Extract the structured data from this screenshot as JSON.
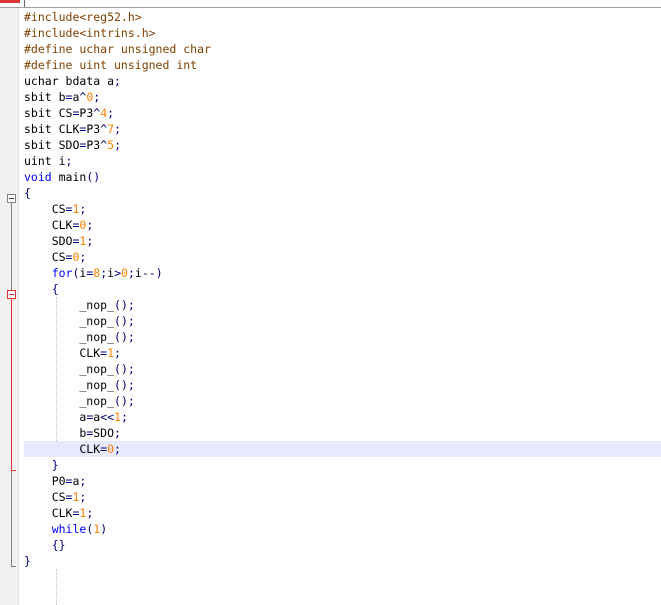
{
  "editor": {
    "lines": [
      [
        {
          "t": "#include<reg52.h>",
          "c": "pp"
        }
      ],
      [
        {
          "t": "#include<intrins.h>",
          "c": "pp"
        }
      ],
      [
        {
          "t": "#define uchar unsigned char",
          "c": "pp"
        }
      ],
      [
        {
          "t": "#define uint unsigned int",
          "c": "pp"
        }
      ],
      [
        {
          "t": "uchar bdata a",
          "c": "id"
        },
        {
          "t": ";",
          "c": "op"
        }
      ],
      [
        {
          "t": "sbit b",
          "c": "id"
        },
        {
          "t": "=",
          "c": "op"
        },
        {
          "t": "a",
          "c": "id"
        },
        {
          "t": "^",
          "c": "op"
        },
        {
          "t": "0",
          "c": "num"
        },
        {
          "t": ";",
          "c": "op"
        }
      ],
      [
        {
          "t": "sbit CS",
          "c": "id"
        },
        {
          "t": "=",
          "c": "op"
        },
        {
          "t": "P3",
          "c": "id"
        },
        {
          "t": "^",
          "c": "op"
        },
        {
          "t": "4",
          "c": "num"
        },
        {
          "t": ";",
          "c": "op"
        }
      ],
      [
        {
          "t": "sbit CLK",
          "c": "id"
        },
        {
          "t": "=",
          "c": "op"
        },
        {
          "t": "P3",
          "c": "id"
        },
        {
          "t": "^",
          "c": "op"
        },
        {
          "t": "7",
          "c": "num"
        },
        {
          "t": ";",
          "c": "op"
        }
      ],
      [
        {
          "t": "sbit SDO",
          "c": "id"
        },
        {
          "t": "=",
          "c": "op"
        },
        {
          "t": "P3",
          "c": "id"
        },
        {
          "t": "^",
          "c": "op"
        },
        {
          "t": "5",
          "c": "num"
        },
        {
          "t": ";",
          "c": "op"
        }
      ],
      [
        {
          "t": "uint i",
          "c": "id"
        },
        {
          "t": ";",
          "c": "op"
        }
      ],
      [
        {
          "t": "void",
          "c": "kw"
        },
        {
          "t": " main",
          "c": "id"
        },
        {
          "t": "()",
          "c": "op"
        }
      ],
      [
        {
          "t": "{",
          "c": "op"
        }
      ],
      [
        {
          "t": "    CS",
          "c": "id"
        },
        {
          "t": "=",
          "c": "op"
        },
        {
          "t": "1",
          "c": "num"
        },
        {
          "t": ";",
          "c": "op"
        }
      ],
      [
        {
          "t": "    CLK",
          "c": "id"
        },
        {
          "t": "=",
          "c": "op"
        },
        {
          "t": "0",
          "c": "num"
        },
        {
          "t": ";",
          "c": "op"
        }
      ],
      [
        {
          "t": "    SDO",
          "c": "id"
        },
        {
          "t": "=",
          "c": "op"
        },
        {
          "t": "1",
          "c": "num"
        },
        {
          "t": ";",
          "c": "op"
        }
      ],
      [
        {
          "t": "    CS",
          "c": "id"
        },
        {
          "t": "=",
          "c": "op"
        },
        {
          "t": "0",
          "c": "num"
        },
        {
          "t": ";",
          "c": "op"
        }
      ],
      [
        {
          "t": "    for",
          "c": "kw"
        },
        {
          "t": "(",
          "c": "op"
        },
        {
          "t": "i",
          "c": "id"
        },
        {
          "t": "=",
          "c": "op"
        },
        {
          "t": "8",
          "c": "num"
        },
        {
          "t": ";",
          "c": "op"
        },
        {
          "t": "i",
          "c": "id"
        },
        {
          "t": ">",
          "c": "op"
        },
        {
          "t": "0",
          "c": "num"
        },
        {
          "t": ";",
          "c": "op"
        },
        {
          "t": "i",
          "c": "id"
        },
        {
          "t": "--)",
          "c": "op"
        }
      ],
      [
        {
          "t": "    {",
          "c": "op"
        }
      ],
      [
        {
          "t": "        _nop_",
          "c": "id"
        },
        {
          "t": "();",
          "c": "op"
        }
      ],
      [
        {
          "t": "        _nop_",
          "c": "id"
        },
        {
          "t": "();",
          "c": "op"
        }
      ],
      [
        {
          "t": "        _nop_",
          "c": "id"
        },
        {
          "t": "();",
          "c": "op"
        }
      ],
      [
        {
          "t": "        CLK",
          "c": "id"
        },
        {
          "t": "=",
          "c": "op"
        },
        {
          "t": "1",
          "c": "num"
        },
        {
          "t": ";",
          "c": "op"
        }
      ],
      [
        {
          "t": "        _nop_",
          "c": "id"
        },
        {
          "t": "();",
          "c": "op"
        }
      ],
      [
        {
          "t": "        _nop_",
          "c": "id"
        },
        {
          "t": "();",
          "c": "op"
        }
      ],
      [
        {
          "t": "        _nop_",
          "c": "id"
        },
        {
          "t": "();",
          "c": "op"
        }
      ],
      [
        {
          "t": "        a",
          "c": "id"
        },
        {
          "t": "=",
          "c": "op"
        },
        {
          "t": "a",
          "c": "id"
        },
        {
          "t": "<<",
          "c": "op"
        },
        {
          "t": "1",
          "c": "num"
        },
        {
          "t": ";",
          "c": "op"
        }
      ],
      [
        {
          "t": "        b",
          "c": "id"
        },
        {
          "t": "=",
          "c": "op"
        },
        {
          "t": "SDO",
          "c": "id"
        },
        {
          "t": ";",
          "c": "op"
        }
      ],
      [
        {
          "t": "        CLK",
          "c": "id"
        },
        {
          "t": "=",
          "c": "op"
        },
        {
          "t": "0",
          "c": "num"
        },
        {
          "t": ";",
          "c": "op"
        }
      ],
      [
        {
          "t": "    }",
          "c": "op"
        }
      ],
      [
        {
          "t": "    P0",
          "c": "id"
        },
        {
          "t": "=",
          "c": "op"
        },
        {
          "t": "a",
          "c": "id"
        },
        {
          "t": ";",
          "c": "op"
        }
      ],
      [
        {
          "t": "    CS",
          "c": "id"
        },
        {
          "t": "=",
          "c": "op"
        },
        {
          "t": "1",
          "c": "num"
        },
        {
          "t": ";",
          "c": "op"
        }
      ],
      [
        {
          "t": "    CLK",
          "c": "id"
        },
        {
          "t": "=",
          "c": "op"
        },
        {
          "t": "1",
          "c": "num"
        },
        {
          "t": ";",
          "c": "op"
        }
      ],
      [
        {
          "t": "    while",
          "c": "kw"
        },
        {
          "t": "(",
          "c": "op"
        },
        {
          "t": "1",
          "c": "num"
        },
        {
          "t": ")",
          "c": "op"
        }
      ],
      [
        {
          "t": "    {}",
          "c": "op"
        }
      ],
      [
        {
          "t": "}",
          "c": "op"
        }
      ]
    ],
    "current_line": 27
  },
  "colors": {
    "preprocessor": "#804000",
    "keyword": "#0000ff",
    "number": "#ff8000",
    "operator": "#000080",
    "current_line_bg": "#e8e8ff",
    "fold_marker_active": "#e03030"
  },
  "icons": {
    "fold_main": "minus-box-icon",
    "fold_for": "minus-box-icon"
  }
}
